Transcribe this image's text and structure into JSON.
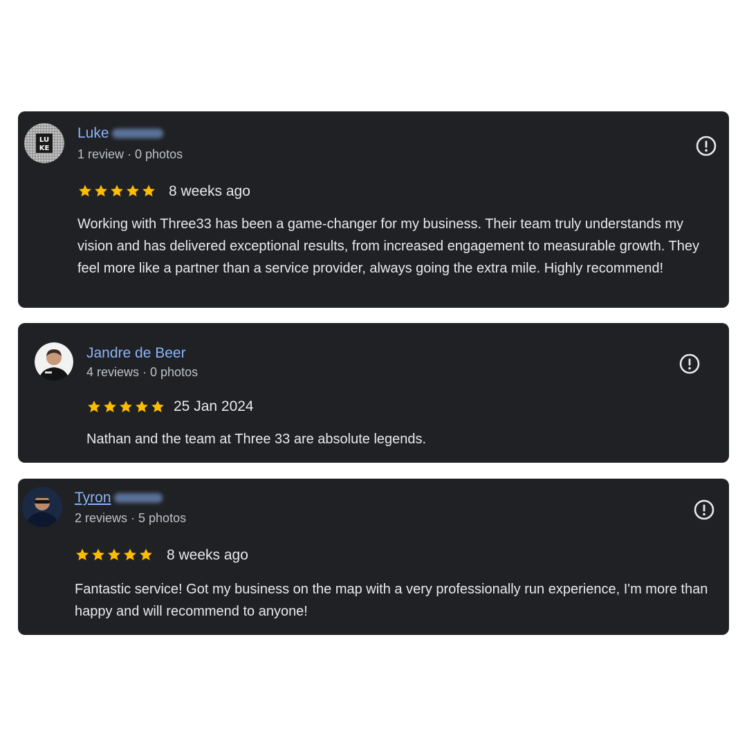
{
  "reviews": [
    {
      "name": "Luke",
      "meta": "1 review · 0 photos",
      "rating": 5,
      "date": "8 weeks ago",
      "text": "Working with Three33 has been a game-changer for my business. Their team truly understands my vision and has delivered exceptional results, from increased engagement to measurable growth. They feel more like a partner than a service provider, always going the extra mile. Highly recommend!",
      "avatar_text_top": "LU",
      "avatar_text_bottom": "KE"
    },
    {
      "name": "Jandre de Beer",
      "meta": "4 reviews · 0 photos",
      "rating": 5,
      "date": "25 Jan 2024",
      "text": "Nathan and the team at Three 33 are absolute legends."
    },
    {
      "name": "Tyron",
      "meta": "2 reviews · 5 photos",
      "rating": 5,
      "date": "8 weeks ago",
      "text": "Fantastic service! Got my business on the map with a very professionally run experience, I'm more than happy and will recommend to anyone!"
    }
  ],
  "colors": {
    "card_bg": "#202124",
    "name": "#8ab4f8",
    "meta": "#bdc1c6",
    "text": "#e8eaed",
    "star": "#fbbc04"
  },
  "icons": {
    "flag": "report-icon",
    "star": "star-icon"
  }
}
